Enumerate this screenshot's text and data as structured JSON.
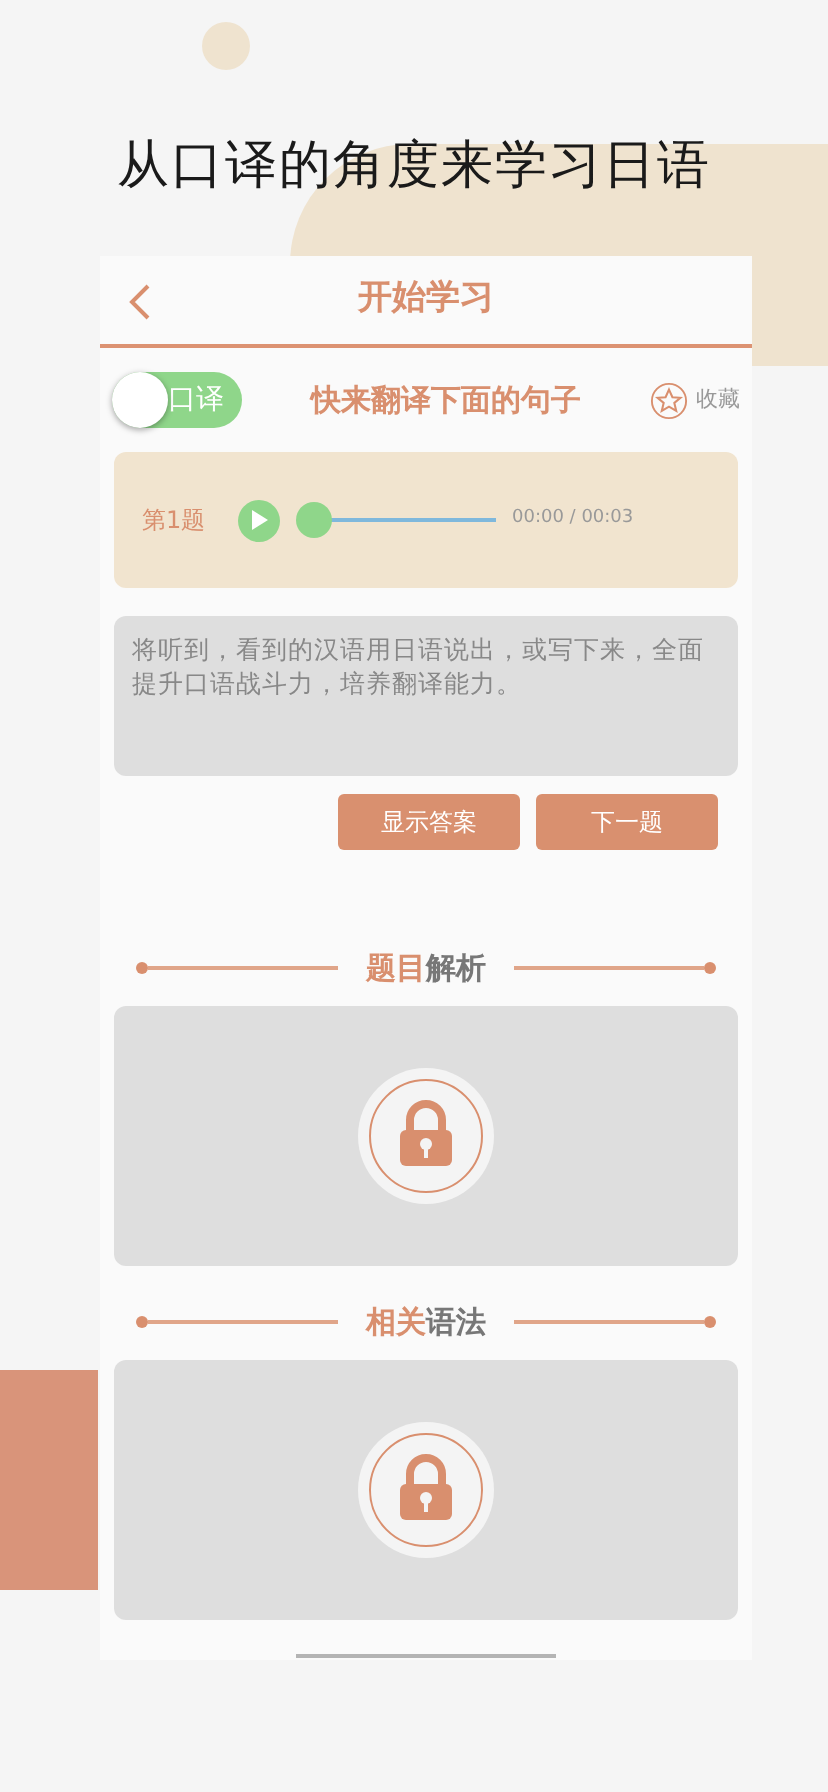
{
  "headline": "从口译的角度来学习日语",
  "header": {
    "title": "开始学习"
  },
  "mode_toggle": {
    "label": "口译",
    "on": false
  },
  "prompt": "快来翻译下面的句子",
  "favorite": {
    "label": "收藏"
  },
  "audio": {
    "question_label": "第1题",
    "level": 0,
    "time": "00:00 / 00:03"
  },
  "answer_field": {
    "placeholder": "将听到，看到的汉语用日语说出，或写下来，全面提升口语战斗力，培养翻译能力。"
  },
  "buttons": [
    "显示答案",
    "下一题"
  ],
  "sections": [
    {
      "title_accent": "题目",
      "title_rest": "解析",
      "locked": true
    },
    {
      "title_accent": "相关",
      "title_rest": "语法",
      "locked": true
    }
  ]
}
